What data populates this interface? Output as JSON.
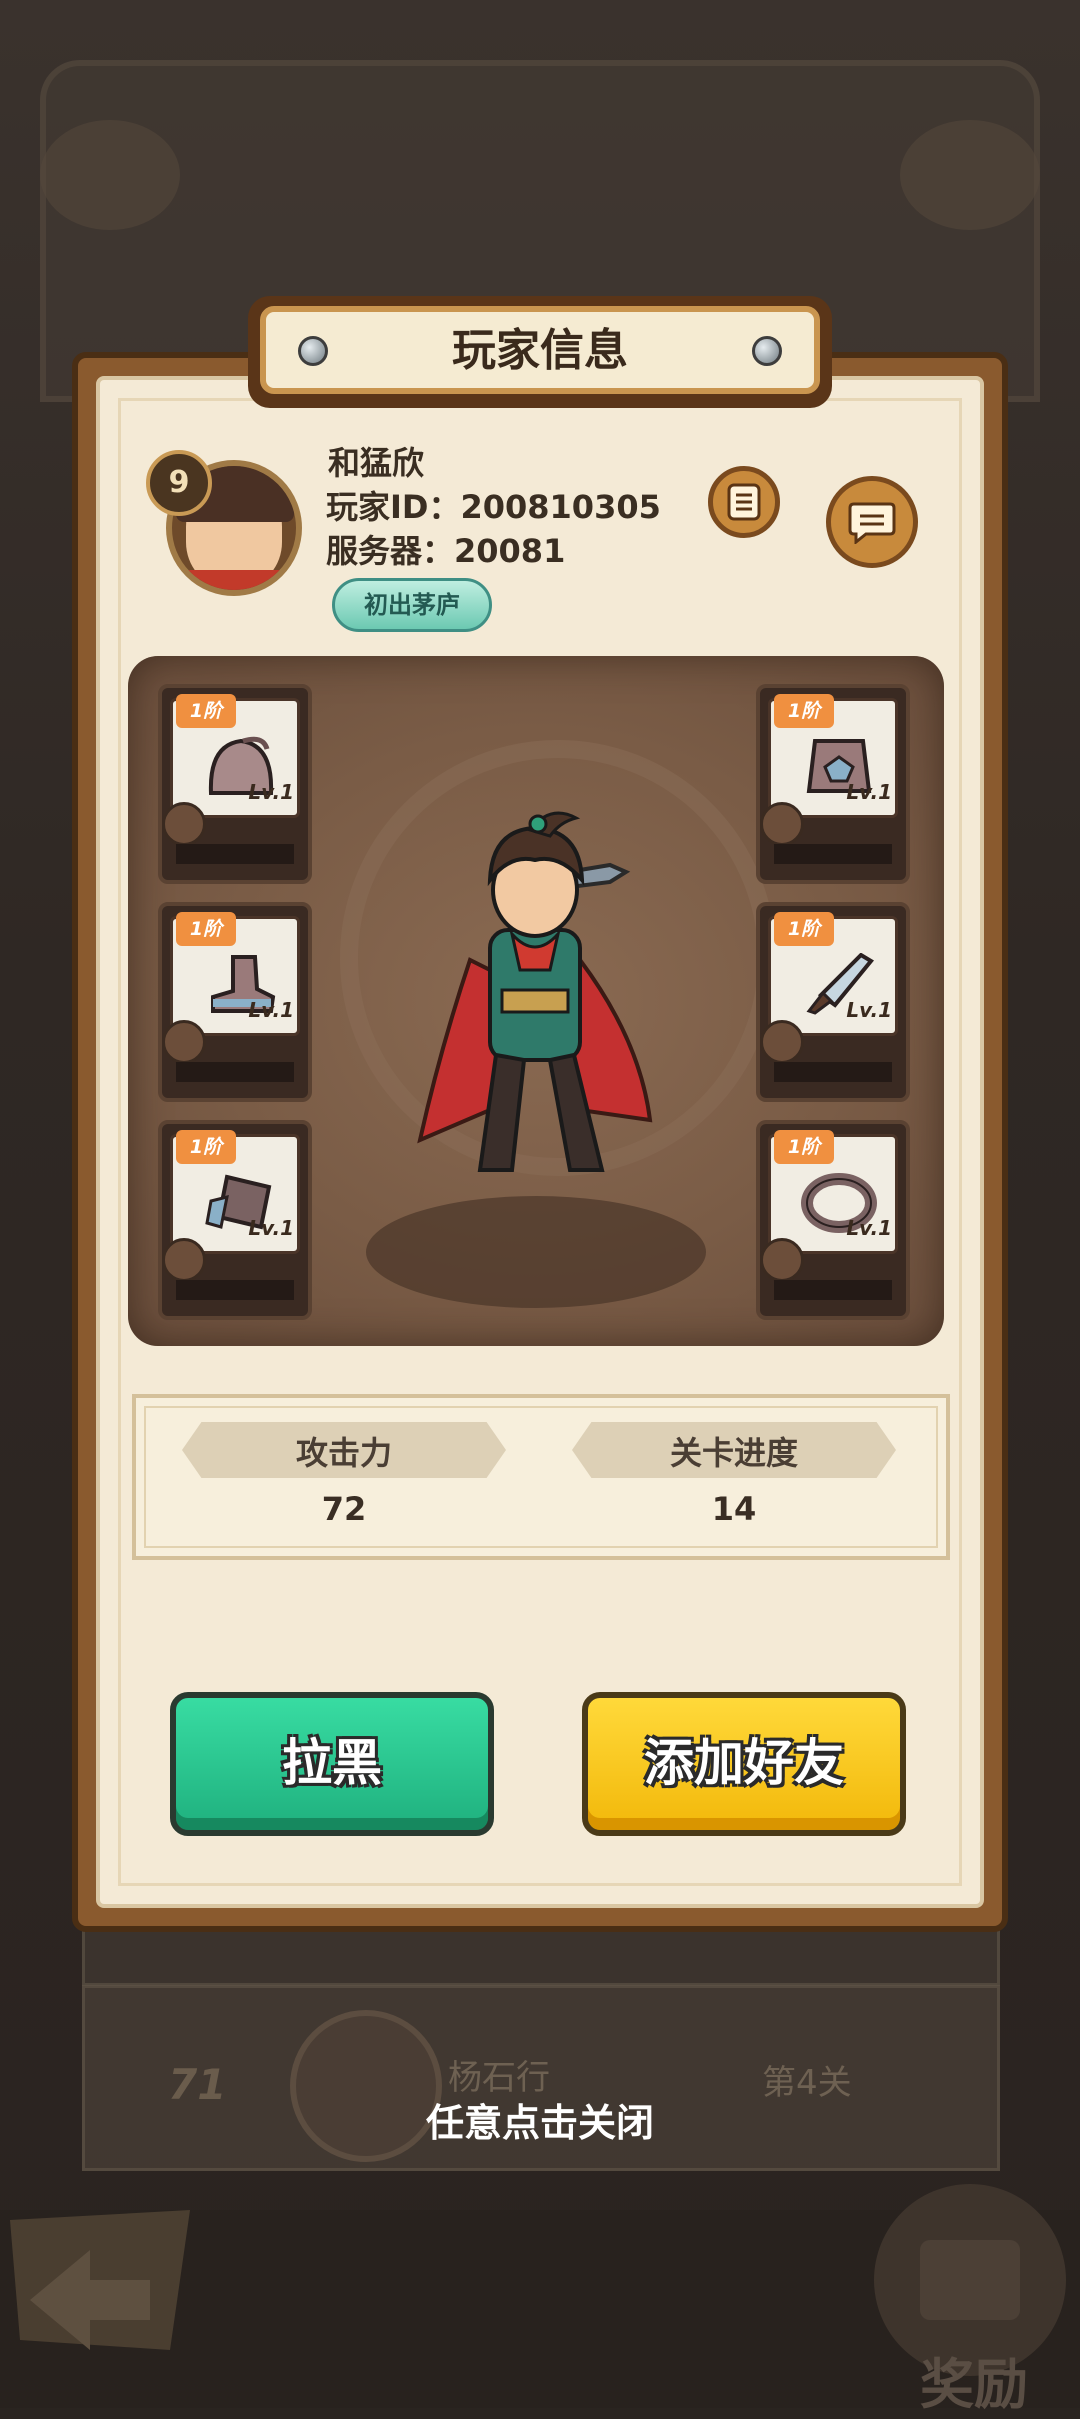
{
  "dialog": {
    "title": "玩家信息"
  },
  "player": {
    "level": "9",
    "name": "和猛欣",
    "id_line": "玩家ID：200810305",
    "server_line": "服务器：20081",
    "rank_badge": "初出茅庐"
  },
  "equipment": {
    "slots": [
      {
        "tier": "1阶",
        "level": "Lv.1",
        "item_icon": "helmet-icon",
        "type_icon": "head-slot-icon"
      },
      {
        "tier": "1阶",
        "level": "Lv.1",
        "item_icon": "armor-icon",
        "type_icon": "body-slot-icon"
      },
      {
        "tier": "1阶",
        "level": "Lv.1",
        "item_icon": "boots-icon",
        "type_icon": "feet-slot-icon"
      },
      {
        "tier": "1阶",
        "level": "Lv.1",
        "item_icon": "sword-icon",
        "type_icon": "weapon-slot-icon"
      },
      {
        "tier": "1阶",
        "level": "Lv.1",
        "item_icon": "bracer-icon",
        "type_icon": "hand-slot-icon"
      },
      {
        "tier": "1阶",
        "level": "Lv.1",
        "item_icon": "ring-icon",
        "type_icon": "ring-slot-icon"
      }
    ]
  },
  "stats": {
    "attack_label": "攻击力",
    "attack_value": "72",
    "progress_label": "关卡进度",
    "progress_value": "14"
  },
  "actions": {
    "block_label": "拉黑",
    "add_friend_label": "添加好友"
  },
  "close_hint": "任意点击关闭",
  "background": {
    "rank": "71",
    "name": "杨石行",
    "level": "第4关",
    "reward_label": "奖励"
  }
}
